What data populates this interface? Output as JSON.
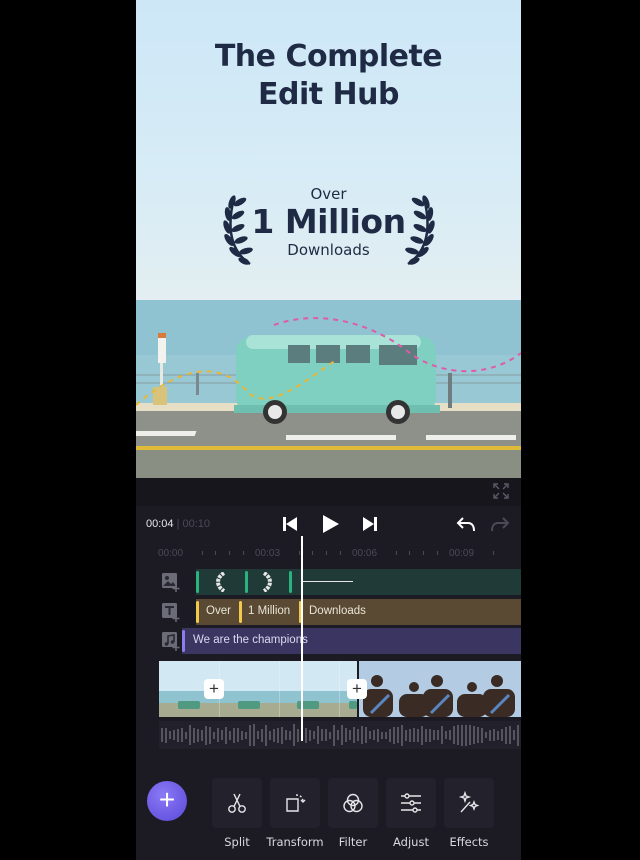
{
  "hero": {
    "title_line1": "The Complete",
    "title_line2": "Edit Hub",
    "award_top": "Over",
    "award_main": "1 Million",
    "award_bottom": "Downloads"
  },
  "player": {
    "current_time": "00:04",
    "separator": "|",
    "total_time": "00:10",
    "icons": [
      "fullscreen-icon",
      "skip-back-icon",
      "play-icon",
      "skip-forward-icon",
      "undo-icon",
      "redo-icon"
    ]
  },
  "ruler": {
    "labels": [
      "00:00",
      "00:03",
      "00:06",
      "00:09"
    ]
  },
  "tracks": {
    "sticker": {
      "icon": "image-add-icon"
    },
    "text": {
      "icon": "text-add-icon",
      "segments": [
        "Over",
        "1 Million",
        "Downloads"
      ]
    },
    "music": {
      "icon": "music-add-icon",
      "label": "We are the champions"
    }
  },
  "clips": {
    "add_label": "+"
  },
  "toolbar": {
    "add_label": "+",
    "tools": [
      {
        "label": "Split",
        "icon": "scissors-icon"
      },
      {
        "label": "Transform",
        "icon": "transform-icon"
      },
      {
        "label": "Filter",
        "icon": "filter-icon"
      },
      {
        "label": "Adjust",
        "icon": "sliders-icon"
      },
      {
        "label": "Effects",
        "icon": "magic-wand-icon"
      }
    ]
  },
  "colors": {
    "accent": "#6a5ae0",
    "sticker_track": "#1f3a37",
    "sticker_marker": "#2bb37f",
    "text_track": "#5a4a33",
    "text_marker": "#f2c94c",
    "music_track": "#3b3562",
    "music_marker": "#8b7cf0",
    "hero_text": "#1f2a44"
  }
}
